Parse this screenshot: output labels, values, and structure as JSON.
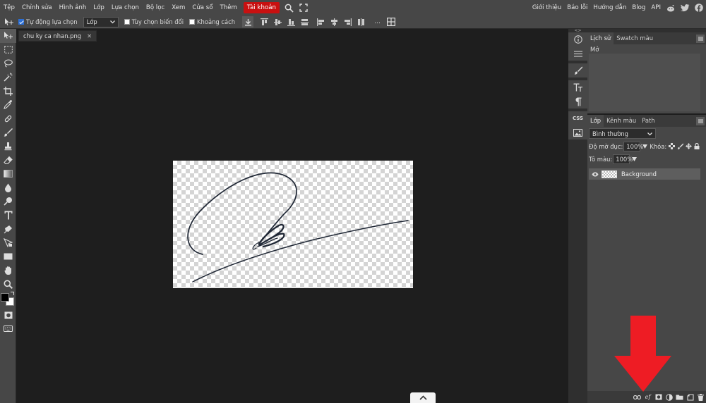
{
  "menu": {
    "items": [
      "Tệp",
      "Chỉnh sửa",
      "Hình ảnh",
      "Lớp",
      "Lựa chọn",
      "Bộ lọc",
      "Xem",
      "Cửa sổ",
      "Thêm"
    ],
    "account": "Tài khoản",
    "right_items": [
      "Giới thiệu",
      "Báo lỗi",
      "Hướng dẫn",
      "Blog",
      "API"
    ]
  },
  "options": {
    "auto_select_label": "Tự động lựa chọn",
    "auto_select_checked": true,
    "layer_select_value": "Lớp",
    "transform_label": "Tùy chọn biến đổi",
    "transform_checked": false,
    "spacing_label": "Khoảng cách",
    "spacing_checked": false,
    "more": "..."
  },
  "document": {
    "tab_name": "chu ky ca nhan.png",
    "close": "✕"
  },
  "history_panel": {
    "tabs": [
      "Lịch sử",
      "Swatch màu"
    ],
    "items": [
      "Mở"
    ]
  },
  "layers_panel": {
    "tabs": [
      "Lớp",
      "Kênh màu",
      "Path"
    ],
    "blend_mode": "Bình thường",
    "opacity_label": "Độ mờ đục:",
    "opacity_value": "100%",
    "lock_label": "Khóa:",
    "fill_label": "Tô màu:",
    "fill_value": "100%",
    "layers": [
      {
        "name": "Background",
        "visible": true
      }
    ]
  },
  "iconcol": {
    "css_label": "CSS"
  },
  "colors": {
    "accent_red": "#c81010",
    "arrow_red": "#ee1c24",
    "foreground": "#000000",
    "background": "#ffffff"
  }
}
